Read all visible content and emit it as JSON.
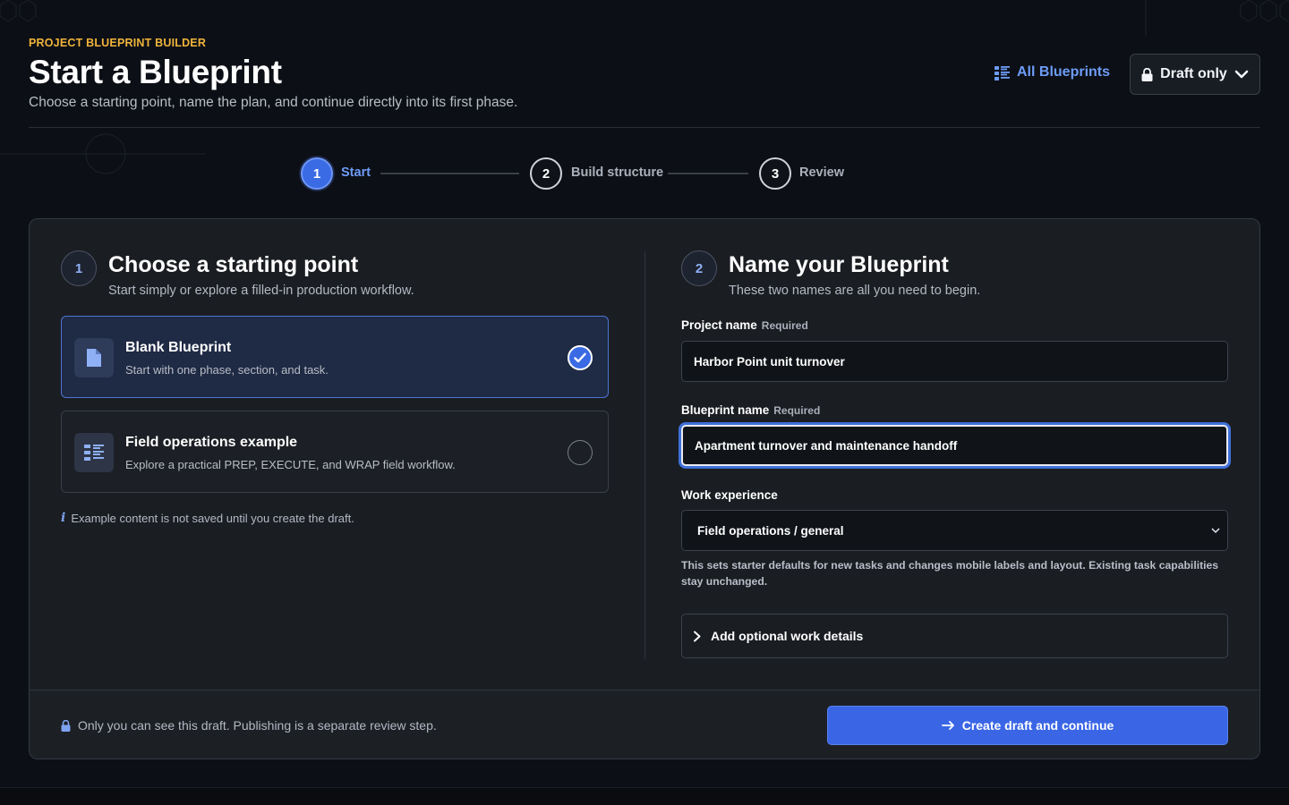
{
  "header": {
    "eyebrow": "PROJECT BLUEPRINT BUILDER",
    "title": "Start a Blueprint",
    "subtitle": "Choose a starting point, name the plan, and continue directly into its first phase.",
    "all_blueprints_label": "All Blueprints",
    "draft_label": "Draft only"
  },
  "stepper": {
    "steps": [
      {
        "number": "1",
        "label": "Start"
      },
      {
        "number": "2",
        "label": "Build structure"
      },
      {
        "number": "3",
        "label": "Review"
      }
    ]
  },
  "left": {
    "number": "1",
    "title": "Choose a starting point",
    "subtitle": "Start simply or explore a filled-in production workflow.",
    "options": [
      {
        "title": "Blank Blueprint",
        "description": "Start with one phase, section, and task."
      },
      {
        "title": "Field operations example",
        "description": "Explore a practical PREP, EXECUTE, and WRAP field workflow."
      }
    ],
    "info_icon": "i",
    "info_note": "Example content is not saved until you create the draft."
  },
  "right": {
    "number": "2",
    "title": "Name your Blueprint",
    "subtitle": "These two names are all you need to begin.",
    "project_name": {
      "label": "Project name",
      "required": "Required",
      "value": "Harbor Point unit turnover"
    },
    "blueprint_name": {
      "label": "Blueprint name",
      "required": "Required",
      "value": "Apartment turnover and maintenance handoff"
    },
    "work_experience": {
      "label": "Work experience",
      "value": "Field operations / general",
      "help": "This sets starter defaults for new tasks and changes mobile labels and layout. Existing task capabilities stay unchanged."
    },
    "optional_details_label": "Add optional work details"
  },
  "footer": {
    "note": "Only you can see this draft. Publishing is a separate review step.",
    "primary_label": "Create draft and continue"
  },
  "colors": {
    "accent": "#3a66e6",
    "eyebrow": "#f0b43c",
    "link": "#6d9cf7",
    "background": "#0c0f15",
    "card": "#1a1d22"
  }
}
